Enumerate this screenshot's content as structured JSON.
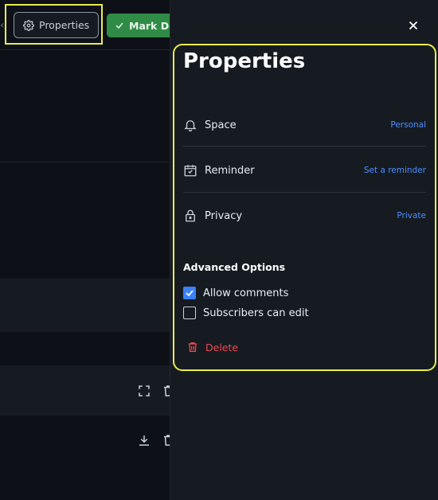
{
  "toolbar": {
    "properties_label": "Properties",
    "mark_done_label": "Mark Do"
  },
  "panel": {
    "title": "Properties",
    "rows": [
      {
        "label": "Space",
        "value": "Personal",
        "icon": "bell-icon"
      },
      {
        "label": "Reminder",
        "value": "Set a reminder",
        "icon": "calendar-check-icon"
      },
      {
        "label": "Privacy",
        "value": "Private",
        "icon": "lock-icon"
      }
    ],
    "advanced_title": "Advanced Options",
    "options": [
      {
        "label": "Allow comments",
        "checked": true
      },
      {
        "label": "Subscribers can edit",
        "checked": false
      }
    ],
    "delete_label": "Delete"
  },
  "colors": {
    "highlight": "#ecec4d",
    "accent_link": "#4c8dff",
    "success": "#2f8b45",
    "danger": "#f0484d",
    "checkbox": "#3b82f6"
  }
}
